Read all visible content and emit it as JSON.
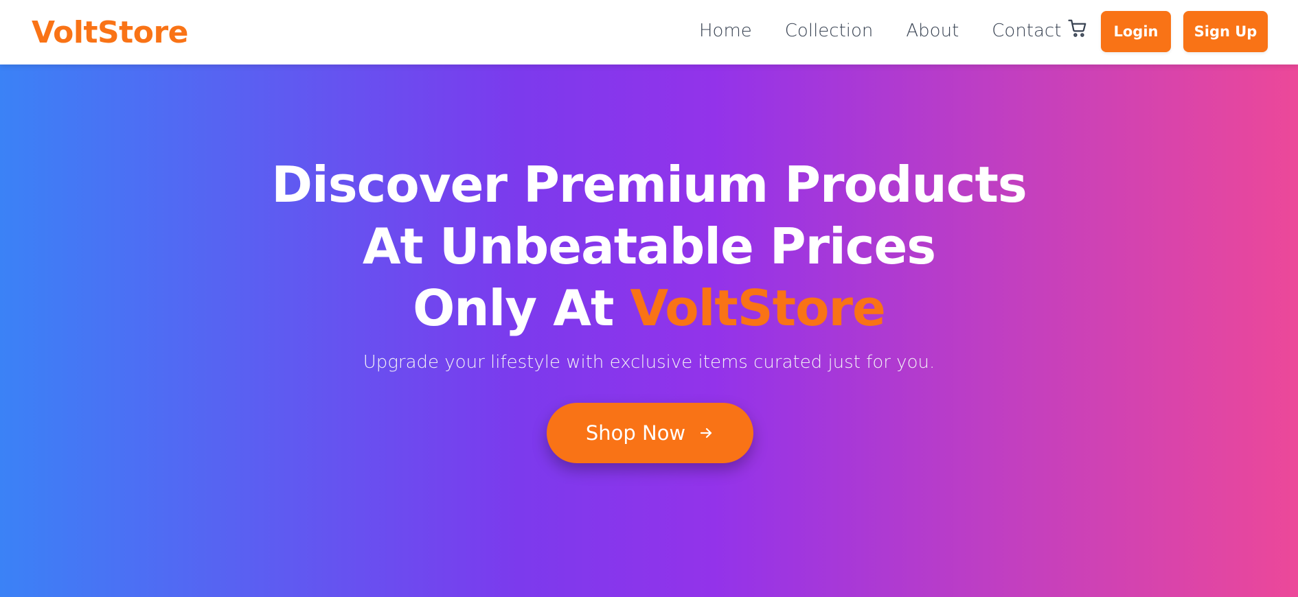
{
  "header": {
    "brand": "VoltStore",
    "nav": [
      {
        "label": "Home"
      },
      {
        "label": "Collection"
      },
      {
        "label": "About"
      },
      {
        "label": "Contact"
      }
    ],
    "cart_icon": "shopping-cart-icon",
    "login_label": "Login",
    "signup_label": "Sign Up"
  },
  "hero": {
    "title_line1": "Discover Premium Products",
    "title_line2": "At Unbeatable Prices",
    "title_line3_prefix": "Only At ",
    "title_line3_accent": "VoltStore",
    "subtitle": "Upgrade your lifestyle with exclusive items curated just for you.",
    "cta_label": "Shop Now",
    "cta_icon": "arrow-right-icon"
  },
  "colors": {
    "accent": "#f97316",
    "gradient_start": "#3b82f6",
    "gradient_mid": "#9333ea",
    "gradient_end": "#ec4899",
    "nav_text": "#374151"
  }
}
